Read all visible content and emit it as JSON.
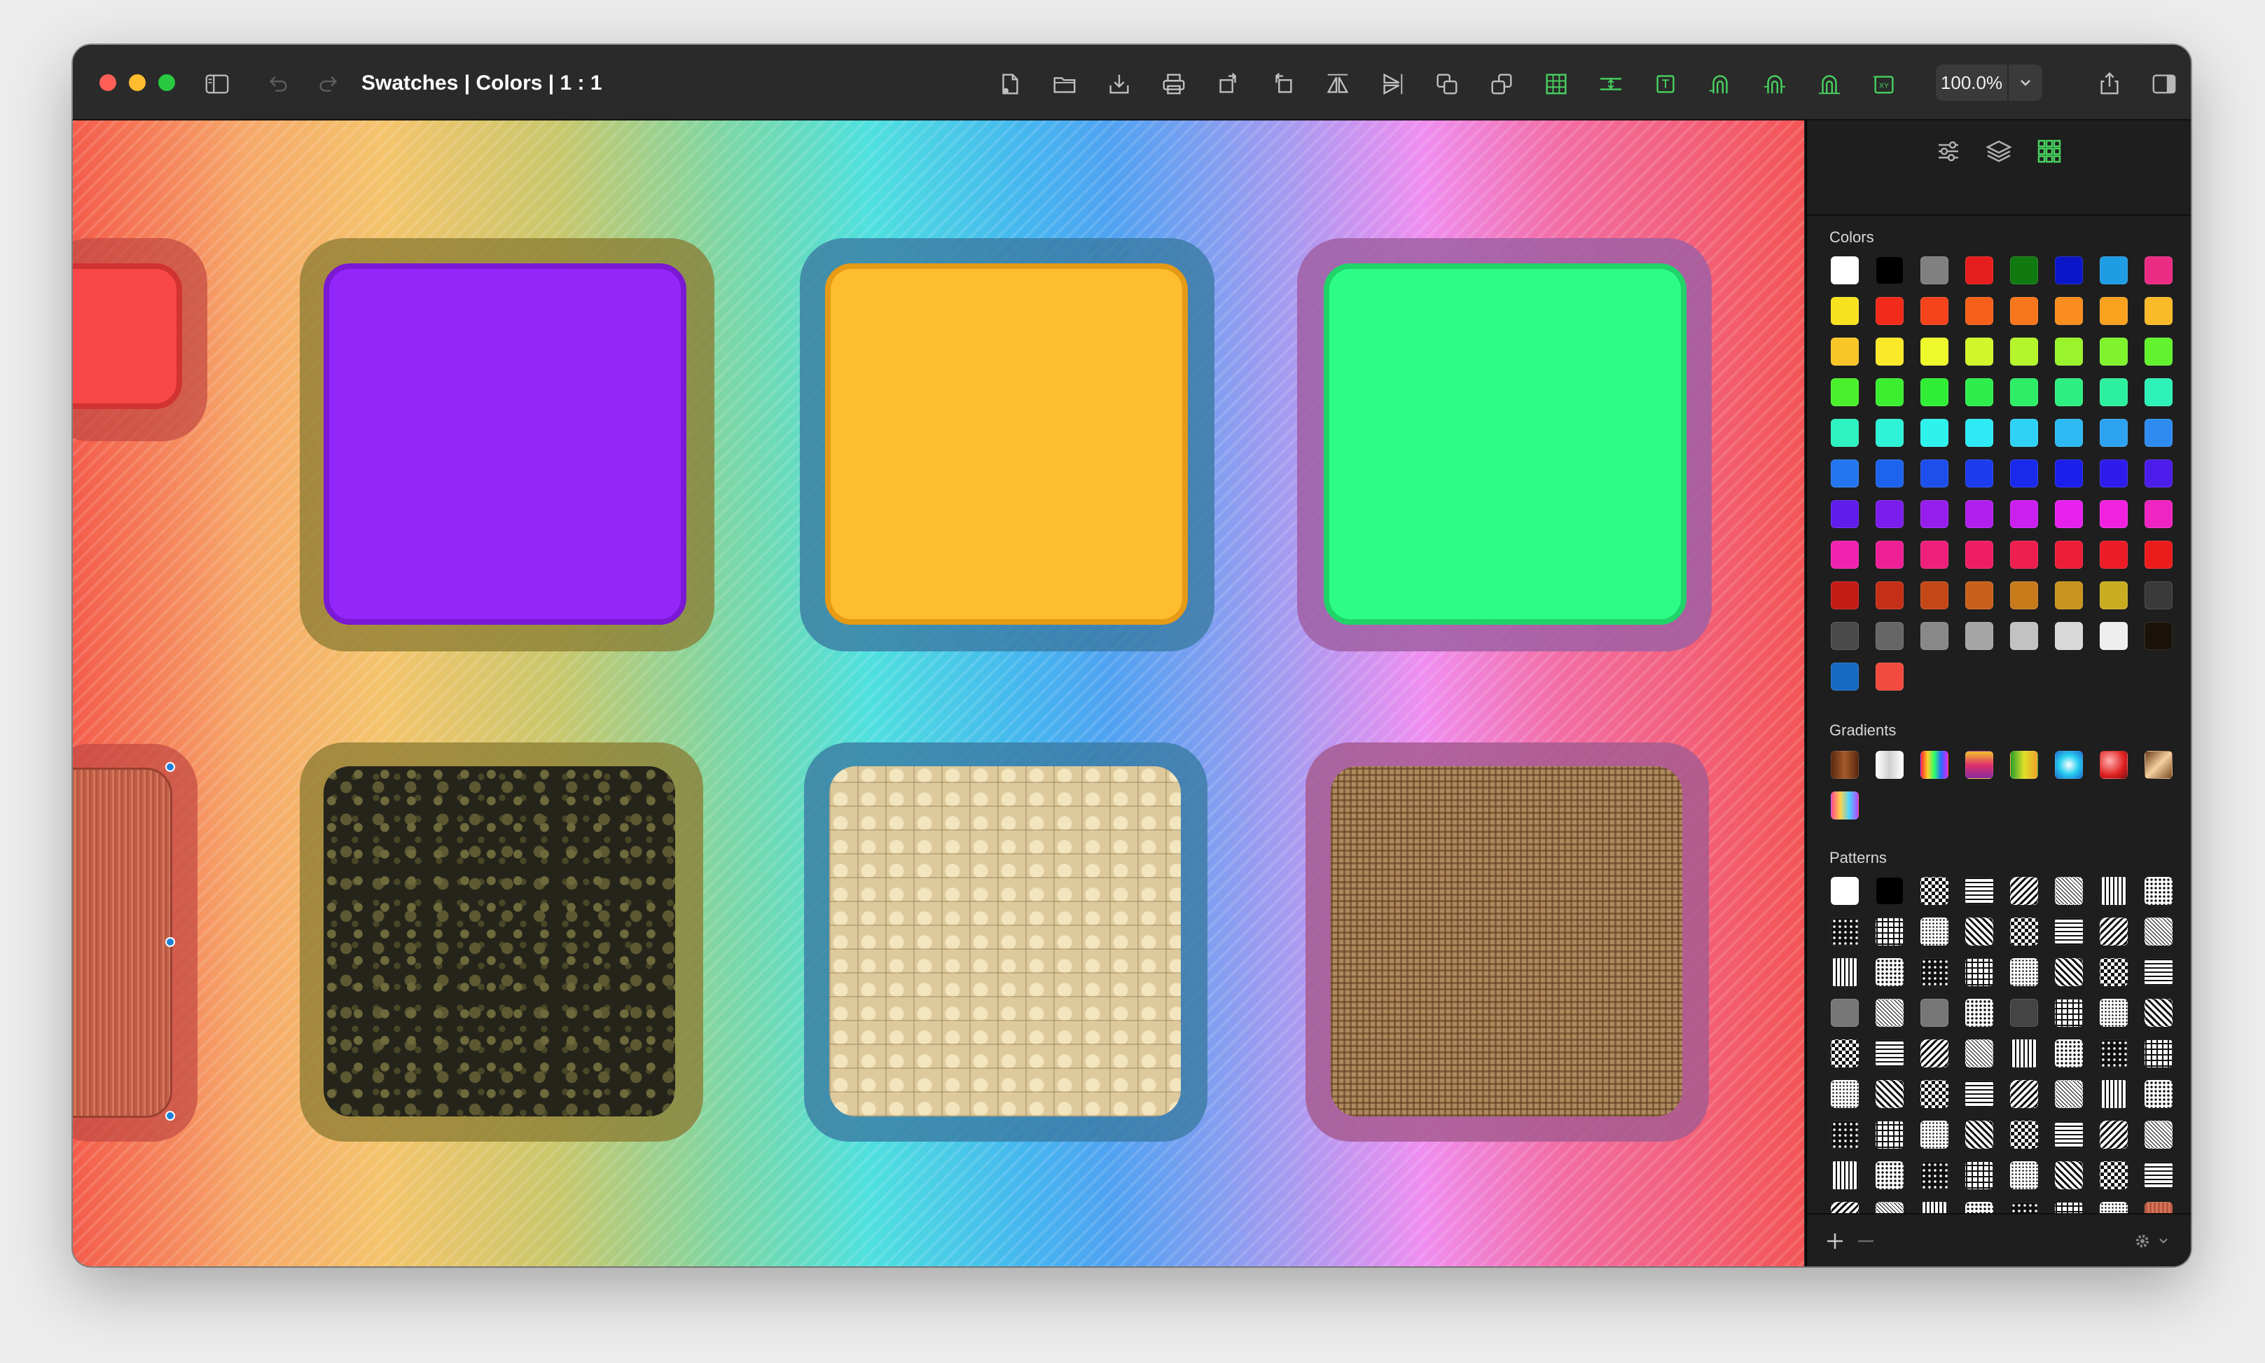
{
  "window": {
    "title": "Swatches | Colors | 1 : 1",
    "zoom": "100.0%"
  },
  "toolbar_icons": [
    "sidebar-toggle-icon",
    "undo-icon",
    "redo-icon",
    "new-document-icon",
    "open-folder-icon",
    "import-icon",
    "print-icon",
    "rotate-right-icon",
    "rotate-left-icon",
    "flip-horizontal-icon",
    "flip-vertical-icon",
    "bring-forward-icon",
    "send-backward-icon",
    "grid-icon",
    "distribute-icon",
    "frame-icon",
    "snap-icon",
    "snap-guides-icon",
    "snap-objects-icon",
    "coordinates-icon",
    "share-icon",
    "inspector-toggle-icon"
  ],
  "canvas": {
    "tiles": [
      {
        "name": "red-swatch-tile",
        "fill": "#f94747",
        "stroke": "#d13232",
        "frame": "#c44a42"
      },
      {
        "name": "purple-swatch-tile",
        "fill": "#9327fa",
        "stroke": "#7a18d4",
        "frame": "#8a7a30"
      },
      {
        "name": "orange-swatch-tile",
        "fill": "#febd2f",
        "stroke": "#e69a16",
        "frame": "#3a7aa2"
      },
      {
        "name": "green-swatch-tile",
        "fill": "#2dfd86",
        "stroke": "#20d46a",
        "frame": "#9f5fa3"
      },
      {
        "name": "red-texture-tile",
        "texture": "red",
        "frame": "#c44a42"
      },
      {
        "name": "stone-texture-tile",
        "texture": "stone",
        "frame": "#8a7a30"
      },
      {
        "name": "sand-texture-tile",
        "texture": "sand",
        "frame": "#3a7aa2"
      },
      {
        "name": "burlap-texture-tile",
        "texture": "burlap",
        "frame": "#a65a90"
      }
    ]
  },
  "sidebar": {
    "tabs": [
      "settings-icon",
      "layers-icon",
      "swatches-grid-icon"
    ],
    "colors_label": "Colors",
    "gradients_label": "Gradients",
    "patterns_label": "Patterns",
    "colors": [
      "#ffffff",
      "#000000",
      "#808080",
      "#e51d1d",
      "#107a10",
      "#0a16c7",
      "#1e9de4",
      "#ec2b85",
      "#f8e21d",
      "#f12a1a",
      "#f5431c",
      "#f6601a",
      "#f8761c",
      "#f98d1e",
      "#f9a21e",
      "#fbba28",
      "#f9c628",
      "#fae829",
      "#eef92b",
      "#d1f72a",
      "#b4f52b",
      "#99f42c",
      "#7ff32d",
      "#62f22e",
      "#4af02c",
      "#3bef30",
      "#30ee36",
      "#2eee4e",
      "#2dee66",
      "#2eef82",
      "#2df09e",
      "#2ef2b8",
      "#2ef2bf",
      "#2ef3d6",
      "#2ef2ec",
      "#2ee9f4",
      "#2ed2f4",
      "#2dbaf2",
      "#2da2f1",
      "#2e8cf0",
      "#2376ef",
      "#1d63ee",
      "#1d4fed",
      "#1c3ced",
      "#1a2aec",
      "#1a1feb",
      "#2d1ceb",
      "#4c1ceb",
      "#5f1ceb",
      "#7b1dec",
      "#961eed",
      "#b11fee",
      "#cb20ef",
      "#e621f0",
      "#f022e0",
      "#f024c3",
      "#ef23b0",
      "#ef1f96",
      "#ef1f7c",
      "#ef1e64",
      "#ee1e4e",
      "#ee1d38",
      "#ed1c26",
      "#ed1c1c",
      "#c41b16",
      "#c62f17",
      "#c44718",
      "#c9611b",
      "#c97b1c",
      "#c9941e",
      "#c9ac20",
      "#3a3a3a",
      "#4a4a4a",
      "#666666",
      "#888888",
      "#a5a5a5",
      "#c2c2c2",
      "#d9d9d9",
      "#eeeeee",
      "#1a1208",
      "#166ac2",
      "#f24a3f"
    ],
    "gradients": [
      "linear-gradient(90deg,#5a2a10,#a65a2a,#5a2a10)",
      "linear-gradient(90deg,#ffffff,#cfcfcf,#ffffff)",
      "linear-gradient(90deg,#ff2a2a,#ffd22a,#2aff6a,#2a6aff,#d22aff)",
      "linear-gradient(180deg,#f2c12a,#e0306a,#8a2aa0)",
      "linear-gradient(90deg,#2aa02a,#e0e02a,#f0a02a)",
      "radial-gradient(circle,#ffffff,#2ad0f0 50%,#1a6ad0)",
      "radial-gradient(circle at 35% 35%,#ffb0b0,#e02020 60%,#801010)",
      "linear-gradient(135deg,#6a3a1a,#f4d0a0,#7a4a20)",
      "linear-gradient(90deg,#ff4a8a,#ffd24a,#4ad2ff,#b04aff)"
    ],
    "patterns_rows": 10
  }
}
